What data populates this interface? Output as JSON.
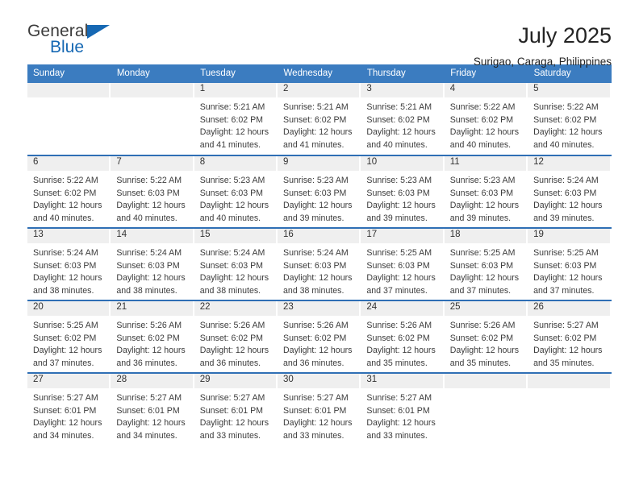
{
  "brand": {
    "name_top": "General",
    "name_bottom": "Blue",
    "accent_color": "#1668b3"
  },
  "header": {
    "title": "July 2025",
    "subtitle": "Surigao, Caraga, Philippines"
  },
  "theme": {
    "header_blue": "#3b7cc0",
    "row_divider_blue": "#2f6fb5",
    "daynum_band": "#efefef"
  },
  "calendar": {
    "weekday_headers": [
      "Sunday",
      "Monday",
      "Tuesday",
      "Wednesday",
      "Thursday",
      "Friday",
      "Saturday"
    ],
    "labels": {
      "sunrise": "Sunrise:",
      "sunset": "Sunset:",
      "daylight": "Daylight:"
    },
    "weeks": [
      [
        {
          "day": "",
          "empty": true
        },
        {
          "day": "",
          "empty": true
        },
        {
          "day": "1",
          "sunrise": "Sunrise: 5:21 AM",
          "sunset": "Sunset: 6:02 PM",
          "daylight": "Daylight: 12 hours and 41 minutes."
        },
        {
          "day": "2",
          "sunrise": "Sunrise: 5:21 AM",
          "sunset": "Sunset: 6:02 PM",
          "daylight": "Daylight: 12 hours and 41 minutes."
        },
        {
          "day": "3",
          "sunrise": "Sunrise: 5:21 AM",
          "sunset": "Sunset: 6:02 PM",
          "daylight": "Daylight: 12 hours and 40 minutes."
        },
        {
          "day": "4",
          "sunrise": "Sunrise: 5:22 AM",
          "sunset": "Sunset: 6:02 PM",
          "daylight": "Daylight: 12 hours and 40 minutes."
        },
        {
          "day": "5",
          "sunrise": "Sunrise: 5:22 AM",
          "sunset": "Sunset: 6:02 PM",
          "daylight": "Daylight: 12 hours and 40 minutes."
        }
      ],
      [
        {
          "day": "6",
          "sunrise": "Sunrise: 5:22 AM",
          "sunset": "Sunset: 6:02 PM",
          "daylight": "Daylight: 12 hours and 40 minutes."
        },
        {
          "day": "7",
          "sunrise": "Sunrise: 5:22 AM",
          "sunset": "Sunset: 6:03 PM",
          "daylight": "Daylight: 12 hours and 40 minutes."
        },
        {
          "day": "8",
          "sunrise": "Sunrise: 5:23 AM",
          "sunset": "Sunset: 6:03 PM",
          "daylight": "Daylight: 12 hours and 40 minutes."
        },
        {
          "day": "9",
          "sunrise": "Sunrise: 5:23 AM",
          "sunset": "Sunset: 6:03 PM",
          "daylight": "Daylight: 12 hours and 39 minutes."
        },
        {
          "day": "10",
          "sunrise": "Sunrise: 5:23 AM",
          "sunset": "Sunset: 6:03 PM",
          "daylight": "Daylight: 12 hours and 39 minutes."
        },
        {
          "day": "11",
          "sunrise": "Sunrise: 5:23 AM",
          "sunset": "Sunset: 6:03 PM",
          "daylight": "Daylight: 12 hours and 39 minutes."
        },
        {
          "day": "12",
          "sunrise": "Sunrise: 5:24 AM",
          "sunset": "Sunset: 6:03 PM",
          "daylight": "Daylight: 12 hours and 39 minutes."
        }
      ],
      [
        {
          "day": "13",
          "sunrise": "Sunrise: 5:24 AM",
          "sunset": "Sunset: 6:03 PM",
          "daylight": "Daylight: 12 hours and 38 minutes."
        },
        {
          "day": "14",
          "sunrise": "Sunrise: 5:24 AM",
          "sunset": "Sunset: 6:03 PM",
          "daylight": "Daylight: 12 hours and 38 minutes."
        },
        {
          "day": "15",
          "sunrise": "Sunrise: 5:24 AM",
          "sunset": "Sunset: 6:03 PM",
          "daylight": "Daylight: 12 hours and 38 minutes."
        },
        {
          "day": "16",
          "sunrise": "Sunrise: 5:24 AM",
          "sunset": "Sunset: 6:03 PM",
          "daylight": "Daylight: 12 hours and 38 minutes."
        },
        {
          "day": "17",
          "sunrise": "Sunrise: 5:25 AM",
          "sunset": "Sunset: 6:03 PM",
          "daylight": "Daylight: 12 hours and 37 minutes."
        },
        {
          "day": "18",
          "sunrise": "Sunrise: 5:25 AM",
          "sunset": "Sunset: 6:03 PM",
          "daylight": "Daylight: 12 hours and 37 minutes."
        },
        {
          "day": "19",
          "sunrise": "Sunrise: 5:25 AM",
          "sunset": "Sunset: 6:03 PM",
          "daylight": "Daylight: 12 hours and 37 minutes."
        }
      ],
      [
        {
          "day": "20",
          "sunrise": "Sunrise: 5:25 AM",
          "sunset": "Sunset: 6:02 PM",
          "daylight": "Daylight: 12 hours and 37 minutes."
        },
        {
          "day": "21",
          "sunrise": "Sunrise: 5:26 AM",
          "sunset": "Sunset: 6:02 PM",
          "daylight": "Daylight: 12 hours and 36 minutes."
        },
        {
          "day": "22",
          "sunrise": "Sunrise: 5:26 AM",
          "sunset": "Sunset: 6:02 PM",
          "daylight": "Daylight: 12 hours and 36 minutes."
        },
        {
          "day": "23",
          "sunrise": "Sunrise: 5:26 AM",
          "sunset": "Sunset: 6:02 PM",
          "daylight": "Daylight: 12 hours and 36 minutes."
        },
        {
          "day": "24",
          "sunrise": "Sunrise: 5:26 AM",
          "sunset": "Sunset: 6:02 PM",
          "daylight": "Daylight: 12 hours and 35 minutes."
        },
        {
          "day": "25",
          "sunrise": "Sunrise: 5:26 AM",
          "sunset": "Sunset: 6:02 PM",
          "daylight": "Daylight: 12 hours and 35 minutes."
        },
        {
          "day": "26",
          "sunrise": "Sunrise: 5:27 AM",
          "sunset": "Sunset: 6:02 PM",
          "daylight": "Daylight: 12 hours and 35 minutes."
        }
      ],
      [
        {
          "day": "27",
          "sunrise": "Sunrise: 5:27 AM",
          "sunset": "Sunset: 6:01 PM",
          "daylight": "Daylight: 12 hours and 34 minutes."
        },
        {
          "day": "28",
          "sunrise": "Sunrise: 5:27 AM",
          "sunset": "Sunset: 6:01 PM",
          "daylight": "Daylight: 12 hours and 34 minutes."
        },
        {
          "day": "29",
          "sunrise": "Sunrise: 5:27 AM",
          "sunset": "Sunset: 6:01 PM",
          "daylight": "Daylight: 12 hours and 33 minutes."
        },
        {
          "day": "30",
          "sunrise": "Sunrise: 5:27 AM",
          "sunset": "Sunset: 6:01 PM",
          "daylight": "Daylight: 12 hours and 33 minutes."
        },
        {
          "day": "31",
          "sunrise": "Sunrise: 5:27 AM",
          "sunset": "Sunset: 6:01 PM",
          "daylight": "Daylight: 12 hours and 33 minutes."
        },
        {
          "day": "",
          "empty": true
        },
        {
          "day": "",
          "empty": true
        }
      ]
    ]
  }
}
